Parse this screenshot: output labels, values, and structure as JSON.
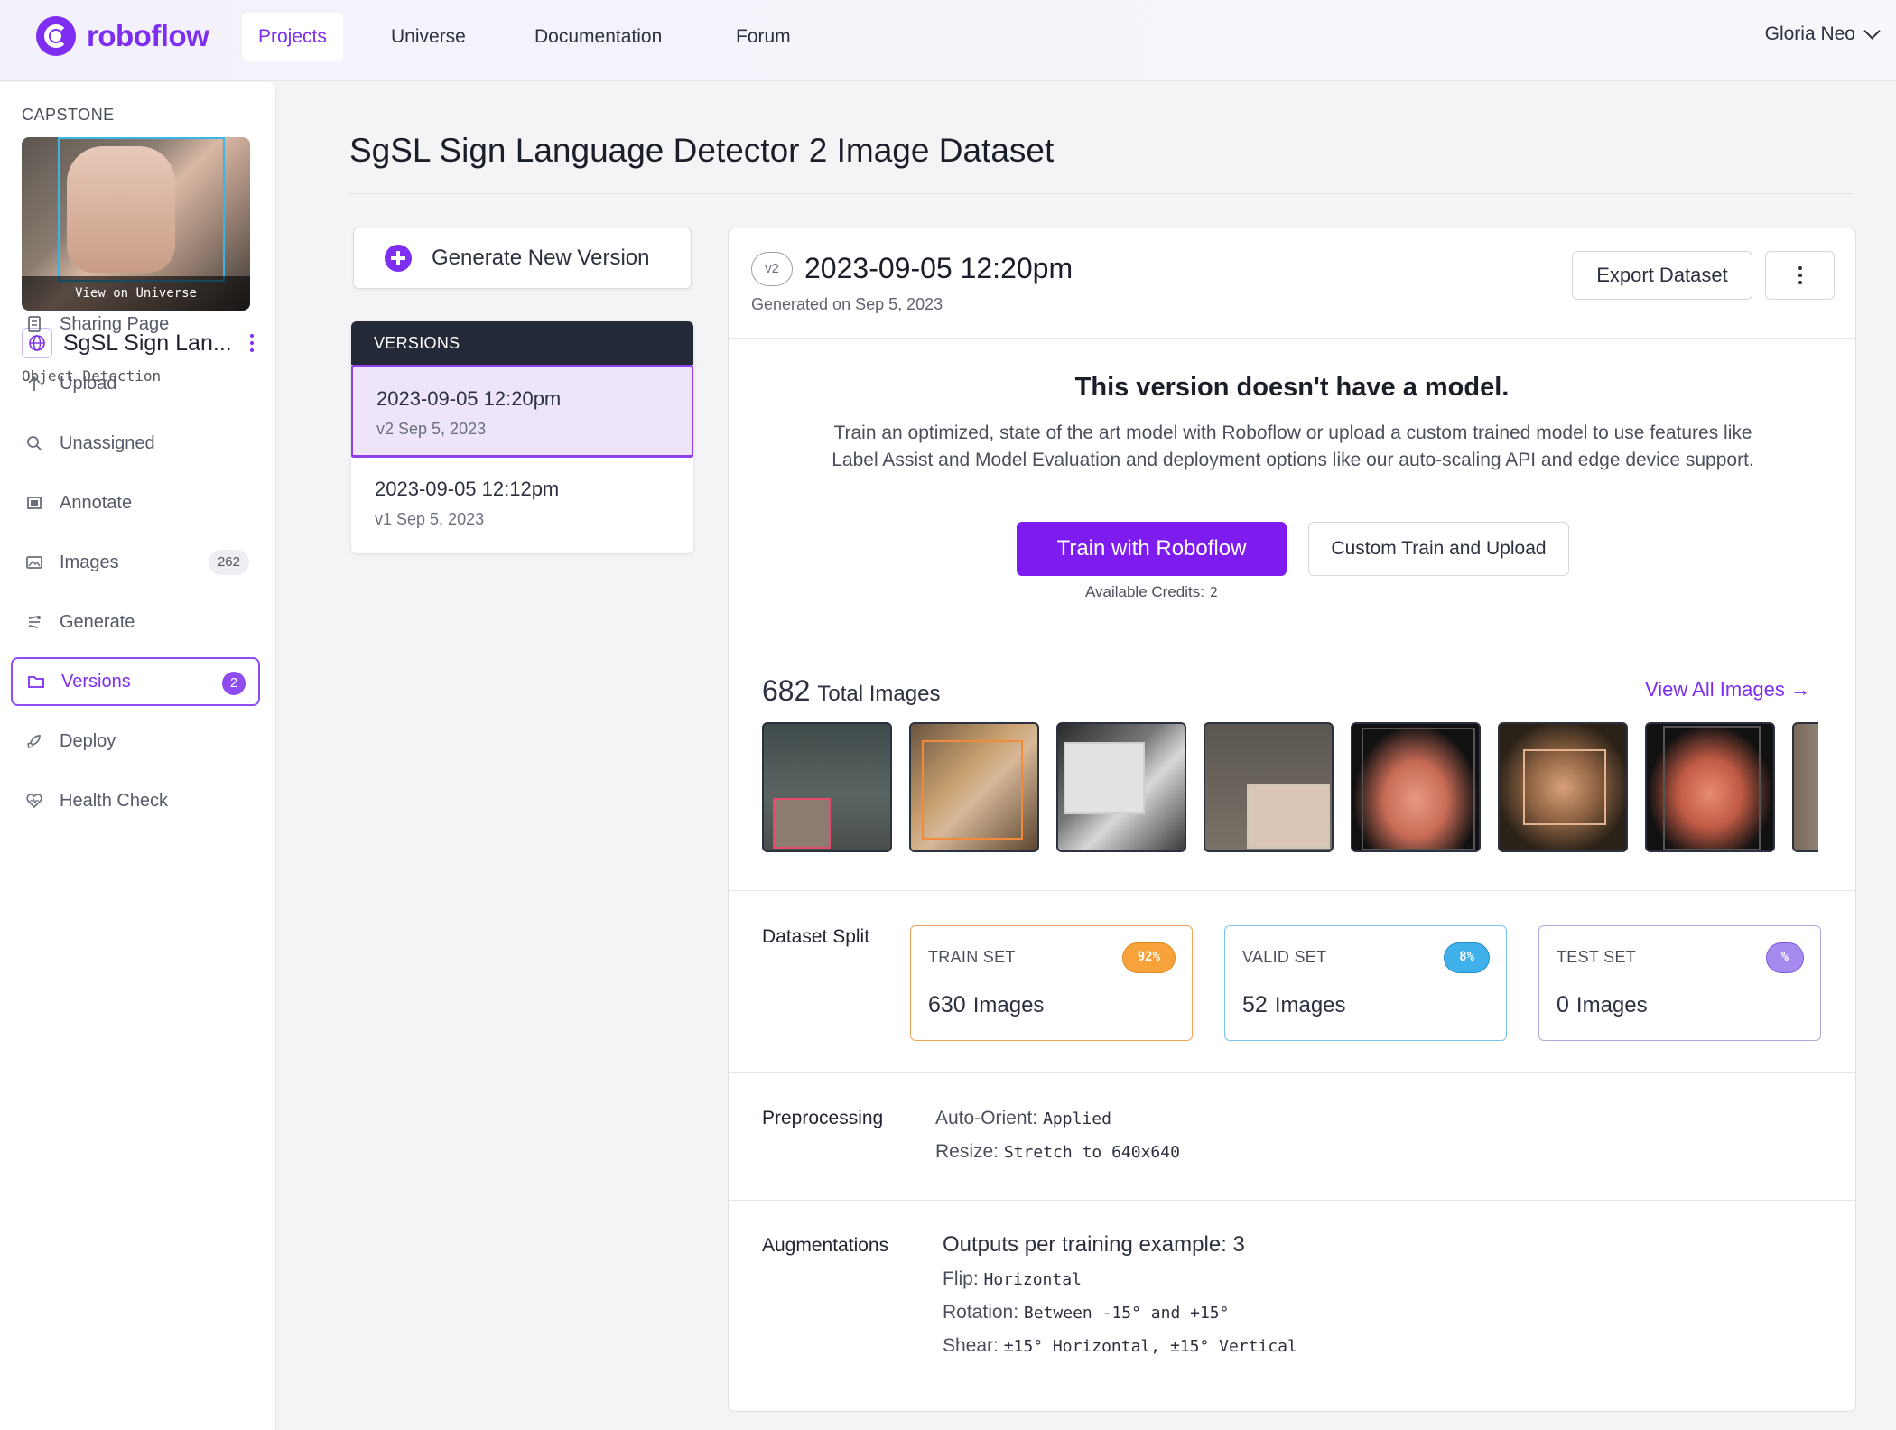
{
  "nav": {
    "logo": "roboflow",
    "items": [
      "Projects",
      "Universe",
      "Documentation",
      "Forum"
    ],
    "user": "Gloria Neo"
  },
  "sidebar": {
    "workspace": "CAPSTONE",
    "thumb_caption": "View on Universe",
    "project_name": "SgSL Sign Lan...",
    "project_type": "Object Detection",
    "items": [
      {
        "label": "Sharing Page",
        "icon": "document-icon"
      },
      {
        "label": "Upload",
        "icon": "arrow-up-icon"
      },
      {
        "label": "Unassigned",
        "icon": "search-icon"
      },
      {
        "label": "Annotate",
        "icon": "annotate-icon"
      },
      {
        "label": "Images",
        "icon": "images-icon",
        "count": "262"
      },
      {
        "label": "Generate",
        "icon": "generate-icon"
      },
      {
        "label": "Versions",
        "icon": "folder-icon",
        "badge": "2"
      },
      {
        "label": "Deploy",
        "icon": "rocket-icon"
      },
      {
        "label": "Health Check",
        "icon": "heart-pulse-icon"
      }
    ]
  },
  "main": {
    "title": "SgSL Sign Language Detector 2 Image Dataset",
    "generate_button": "Generate New Version",
    "versions_header": "VERSIONS",
    "versions": [
      {
        "date": "2023-09-05 12:20pm",
        "sub": "v2 Sep 5, 2023"
      },
      {
        "date": "2023-09-05 12:12pm",
        "sub": "v1 Sep 5, 2023"
      }
    ]
  },
  "panel": {
    "version_tag": "v2",
    "title": "2023-09-05 12:20pm",
    "subtitle": "Generated on Sep 5, 2023",
    "export_button": "Export Dataset",
    "no_model_title": "This version doesn't have a model.",
    "no_model_desc": "Train an optimized, state of the art model with Roboflow or upload a custom trained model to use features like Label Assist and Model Evaluation and deployment options like our auto-scaling API and edge device support.",
    "train_button": "Train with Roboflow",
    "custom_button": "Custom Train and Upload",
    "credits_label": "Available Credits:",
    "credits_value": "2",
    "total_count": "682",
    "total_label": "Total Images",
    "view_all": "View All Images →",
    "split_label": "Dataset Split",
    "splits": [
      {
        "name": "TRAIN SET",
        "pct": "92%",
        "count": "630",
        "unit": "Images",
        "color": "#f0932b",
        "bg": "#f7a23a"
      },
      {
        "name": "VALID SET",
        "pct": "8%",
        "count": "52",
        "unit": "Images",
        "color": "#58b8ea",
        "bg": "#3fb0ea"
      },
      {
        "name": "TEST SET",
        "pct": "%",
        "count": "0",
        "unit": "Images",
        "color": "#9a86d8",
        "bg": "#a58af0"
      }
    ],
    "preprocessing_label": "Preprocessing",
    "preprocessing": [
      {
        "key": "Auto-Orient:",
        "value": "Applied"
      },
      {
        "key": "Resize:",
        "value": "Stretch to 640x640"
      }
    ],
    "augmentations_label": "Augmentations",
    "augment_outputs": "Outputs per training example: 3",
    "augmentations": [
      {
        "key": "Flip:",
        "value": "Horizontal"
      },
      {
        "key": "Rotation:",
        "value": "Between -15° and +15°"
      },
      {
        "key": "Shear:",
        "value": "±15° Horizontal, ±15° Vertical"
      }
    ]
  }
}
